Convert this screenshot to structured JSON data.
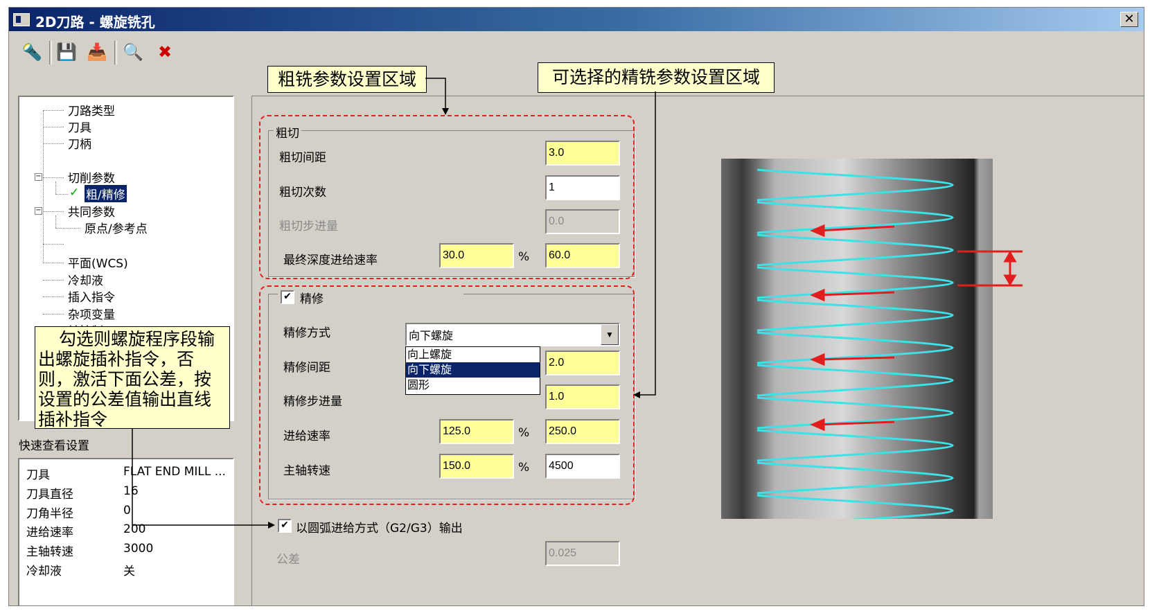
{
  "window": {
    "title": "2D刀路 - 螺旋铣孔",
    "close_label": "✕"
  },
  "toolbar": {
    "items": [
      {
        "name": "tool-icon",
        "glyph": "🔦"
      },
      {
        "name": "save-icon",
        "glyph": "💾"
      },
      {
        "name": "save-as-icon",
        "glyph": "📥"
      },
      {
        "name": "find-icon",
        "glyph": "🔍"
      },
      {
        "name": "delete-icon",
        "glyph": "✖"
      }
    ]
  },
  "tree": {
    "items": [
      {
        "label": "刀路类型"
      },
      {
        "label": "刀具"
      },
      {
        "label": "刀柄"
      },
      {
        "label": "切削参数"
      },
      {
        "label": "粗/精修",
        "check": "✓"
      },
      {
        "label": "共同参数"
      },
      {
        "label": "原点/参考点"
      },
      {
        "label": "平面(WCS)"
      },
      {
        "label": "冷却液"
      },
      {
        "label": "插入指令"
      },
      {
        "label": "杂项变量"
      },
      {
        "label": "轴控制"
      }
    ]
  },
  "quick": {
    "title": "快速查看设置",
    "rows": [
      {
        "label": "刀具",
        "value": "FLAT END MILL ..."
      },
      {
        "label": "刀具直径",
        "value": "16"
      },
      {
        "label": "刀角半径",
        "value": "0"
      },
      {
        "label": "进给速率",
        "value": "200"
      },
      {
        "label": "主轴转速",
        "value": "3000"
      },
      {
        "label": "冷却液",
        "value": "关"
      }
    ]
  },
  "rough": {
    "legend": "粗切",
    "spacing_label": "粗切间距",
    "spacing_value": "3.0",
    "passes_label": "粗切次数",
    "passes_value": "1",
    "step_label": "粗切步进量",
    "step_value": "0.0",
    "final_label": "最终深度进给速率",
    "final_pct": "30.0",
    "final_value": "60.0",
    "pct_sign": "%"
  },
  "finish": {
    "legend": "精修",
    "checked": "✔",
    "mode_label": "精修方式",
    "mode_value": "向下螺旋",
    "mode_options": [
      "向上螺旋",
      "向下螺旋",
      "圆形"
    ],
    "spacing_label": "精修间距",
    "spacing_value": "2.0",
    "step_label": "精修步进量",
    "step_value": "1.0",
    "feed_label": "进给速率",
    "feed_pct": "125.0",
    "feed_value": "250.0",
    "spindle_label": "主轴转速",
    "spindle_pct": "150.0",
    "spindle_value": "4500",
    "pct_sign": "%"
  },
  "arc_output": {
    "checked": "✔",
    "label": "以圆弧进给方式（G2/G3）输出"
  },
  "tolerance": {
    "label": "公差",
    "value": "0.025"
  },
  "callouts": {
    "rough": "粗铣参数设置区域",
    "finish": "可选择的精铣参数设置区域",
    "arc": "勾选则螺旋程序段输出螺旋插补指令，否则，激活下面公差，按设置的公差值输出直线插补指令"
  },
  "colors": {
    "callout_bg": "#ffffcc",
    "highlight_field": "#ffff99",
    "annotation_red": "#e21d1d",
    "helix": "#3fe0e8",
    "selection": "#0a246a"
  }
}
